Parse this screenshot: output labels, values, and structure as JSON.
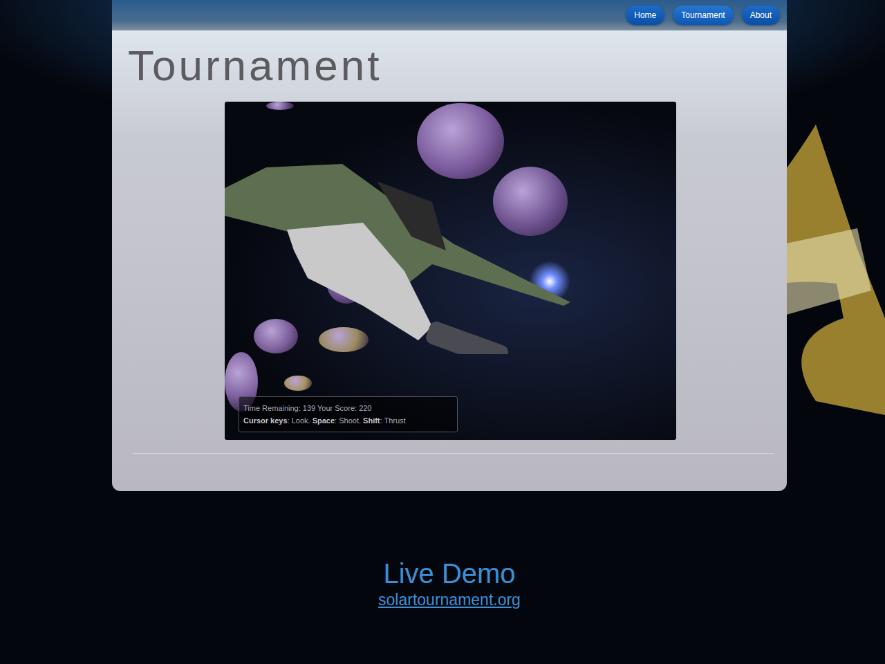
{
  "nav": [
    {
      "label": "Home",
      "selected": false
    },
    {
      "label": "Tournament",
      "selected": true
    },
    {
      "label": "About",
      "selected": false
    }
  ],
  "page": {
    "title": "Tournament"
  },
  "game": {
    "hud": {
      "status": "Time Remaining: 139 Your Score: 220",
      "controls": [
        {
          "key": "Cursor keys",
          "action": ": Look. "
        },
        {
          "key": "Space",
          "action": ": Shoot. "
        },
        {
          "key": "Shift",
          "action": ": Thrust"
        }
      ]
    }
  },
  "footer": {
    "heading": "Live Demo",
    "link": "solartournament.org"
  }
}
